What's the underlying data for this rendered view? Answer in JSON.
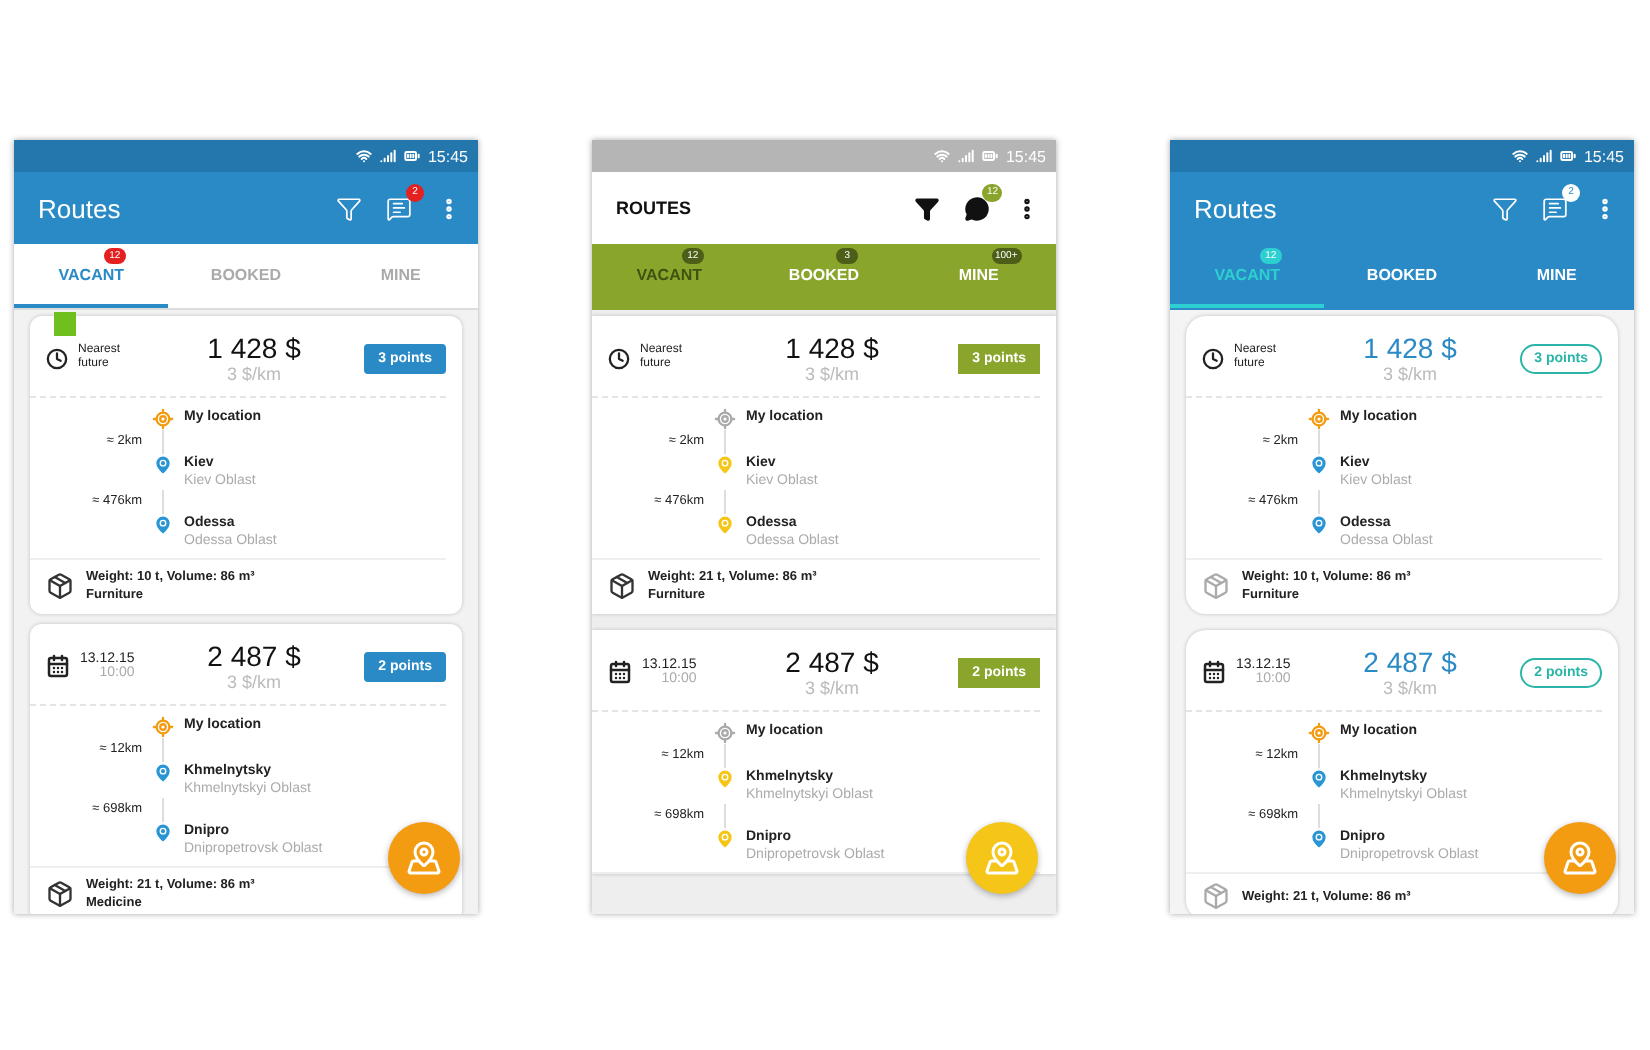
{
  "phones": [
    {
      "kind": "blue",
      "status_time": "15:45",
      "title": "Routes",
      "chat_badge": "2",
      "tabs": [
        {
          "label": "VACANT",
          "badge": "12",
          "selected": true
        },
        {
          "label": "BOOKED",
          "selected": false
        },
        {
          "label": "MINE",
          "selected": false
        }
      ],
      "routes": [
        {
          "kind": "nearest",
          "when": "Nearest future",
          "flagged": true,
          "price": "1 428 $",
          "rate": "3 $/km",
          "points": "3 points",
          "stops": [
            {
              "kind": "origin",
              "name": "My location"
            },
            {
              "kind": "pin",
              "distance": "≈ 2km",
              "name": "Kiev",
              "region": "Kiev Oblast"
            },
            {
              "kind": "pin",
              "distance": "≈ 476km",
              "name": "Odessa",
              "region": "Odessa Oblast"
            }
          ],
          "cargo": [
            "Weight: 10 t, Volume: 86 m³",
            "Furniture"
          ]
        },
        {
          "kind": "date",
          "when": "13.12.15",
          "time": "10:00",
          "flagged": false,
          "price": "2 487 $",
          "rate": "3 $/km",
          "points": "2 points",
          "stops": [
            {
              "kind": "origin",
              "name": "My location"
            },
            {
              "kind": "pin",
              "distance": "≈ 12km",
              "name": "Khmelnytsky",
              "region": "Khmelnytskyi Oblast"
            },
            {
              "kind": "pin",
              "distance": "≈ 698km",
              "name": "Dnipro",
              "region": "Dnipropetrovsk Oblast"
            }
          ],
          "cargo": [
            "Weight: 21 t, Volume: 86 m³",
            "Medicine"
          ]
        }
      ]
    },
    {
      "kind": "green",
      "status_time": "15:45",
      "title": "ROUTES",
      "chat_badge": "12",
      "tabs": [
        {
          "label": "VACANT",
          "badge": "12",
          "selected": true
        },
        {
          "label": "BOOKED",
          "badge": "3",
          "selected": false
        },
        {
          "label": "MINE",
          "badge": "100+",
          "selected": false
        }
      ],
      "routes": [
        {
          "kind": "nearest",
          "when": "Nearest future",
          "flagged": false,
          "price": "1 428 $",
          "rate": "3 $/km",
          "points": "3 points",
          "stops": [
            {
              "kind": "origin",
              "name": "My location"
            },
            {
              "kind": "pin",
              "distance": "≈ 2km",
              "name": "Kiev",
              "region": "Kiev Oblast"
            },
            {
              "kind": "pin",
              "distance": "≈ 476km",
              "name": "Odessa",
              "region": "Odessa Oblast"
            }
          ],
          "cargo": [
            "Weight: 21 t, Volume: 86 m³",
            "Furniture"
          ]
        },
        {
          "kind": "date",
          "when": "13.12.15",
          "time": "10:00",
          "flagged": false,
          "price": "2 487 $",
          "rate": "3 $/km",
          "points": "2 points",
          "stops": [
            {
              "kind": "origin",
              "name": "My location"
            },
            {
              "kind": "pin",
              "distance": "≈ 12km",
              "name": "Khmelnytsky",
              "region": "Khmelnytskyi Oblast"
            },
            {
              "kind": "pin",
              "distance": "≈ 698km",
              "name": "Dnipro",
              "region": "Dnipropetrovsk Oblast"
            }
          ]
        }
      ]
    },
    {
      "kind": "teal",
      "status_time": "15:45",
      "title": "Routes",
      "chat_badge": "2",
      "tabs": [
        {
          "label": "VACANT",
          "badge": "12",
          "selected": true
        },
        {
          "label": "BOOKED",
          "selected": false
        },
        {
          "label": "MINE",
          "selected": false
        }
      ],
      "routes": [
        {
          "kind": "nearest",
          "when": "Nearest future",
          "flagged": false,
          "price": "1 428 $",
          "rate": "3 $/km",
          "points": "3 points",
          "stops": [
            {
              "kind": "origin",
              "name": "My location"
            },
            {
              "kind": "pin",
              "distance": "≈ 2km",
              "name": "Kiev",
              "region": "Kiev Oblast"
            },
            {
              "kind": "pin",
              "distance": "≈ 476km",
              "name": "Odessa",
              "region": "Odessa Oblast"
            }
          ],
          "cargo": [
            "Weight: 10 t, Volume: 86 m³",
            "Furniture"
          ]
        },
        {
          "kind": "date",
          "when": "13.12.15",
          "time": "10:00",
          "flagged": false,
          "price": "2 487 $",
          "rate": "3 $/km",
          "points": "2 points",
          "stops": [
            {
              "kind": "origin",
              "name": "My location"
            },
            {
              "kind": "pin",
              "distance": "≈ 12km",
              "name": "Khmelnytsky",
              "region": "Khmelnytskyi Oblast"
            },
            {
              "kind": "pin",
              "distance": "≈ 698km",
              "name": "Dnipro",
              "region": "Dnipropetrovsk Oblast"
            }
          ],
          "cargo": [
            "Weight: 21 t, Volume: 86 m³"
          ]
        }
      ]
    }
  ]
}
